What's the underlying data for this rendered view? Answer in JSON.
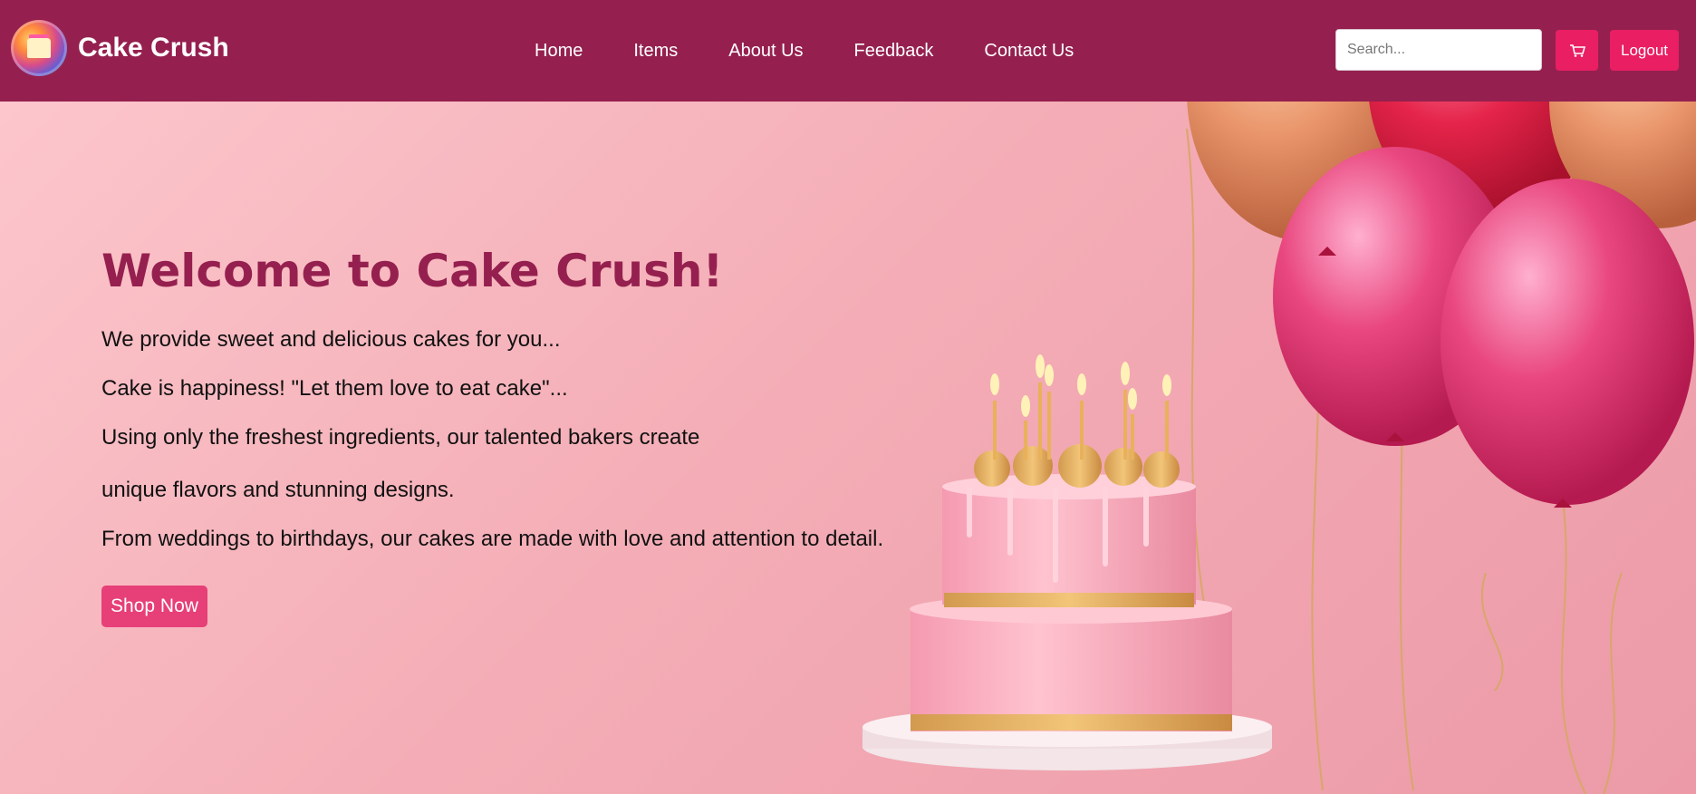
{
  "brand": {
    "name": "Cake Crush",
    "logo_icon": "cake-logo-icon"
  },
  "nav": {
    "items": [
      {
        "label": "Home"
      },
      {
        "label": "Items"
      },
      {
        "label": "About Us"
      },
      {
        "label": "Feedback"
      },
      {
        "label": "Contact Us"
      }
    ]
  },
  "search": {
    "placeholder": "Search..."
  },
  "cart": {
    "icon": "cart-icon"
  },
  "logout": {
    "label": "Logout"
  },
  "hero": {
    "title": "Welcome to Cake Crush!",
    "lines": [
      "We provide sweet and delicious cakes for you...",
      "Cake is happiness! \"Let them love to eat cake\"...",
      "Using only the freshest ingredients, our talented bakers create",
      "unique flavors and stunning designs.",
      "From weddings to birthdays, our cakes are made with love and attention to detail."
    ],
    "cta_label": "Shop Now"
  },
  "colors": {
    "header_bg": "#95204f",
    "accent": "#e91e63",
    "title": "#95204f",
    "hero_bg": "#f4adb6"
  }
}
